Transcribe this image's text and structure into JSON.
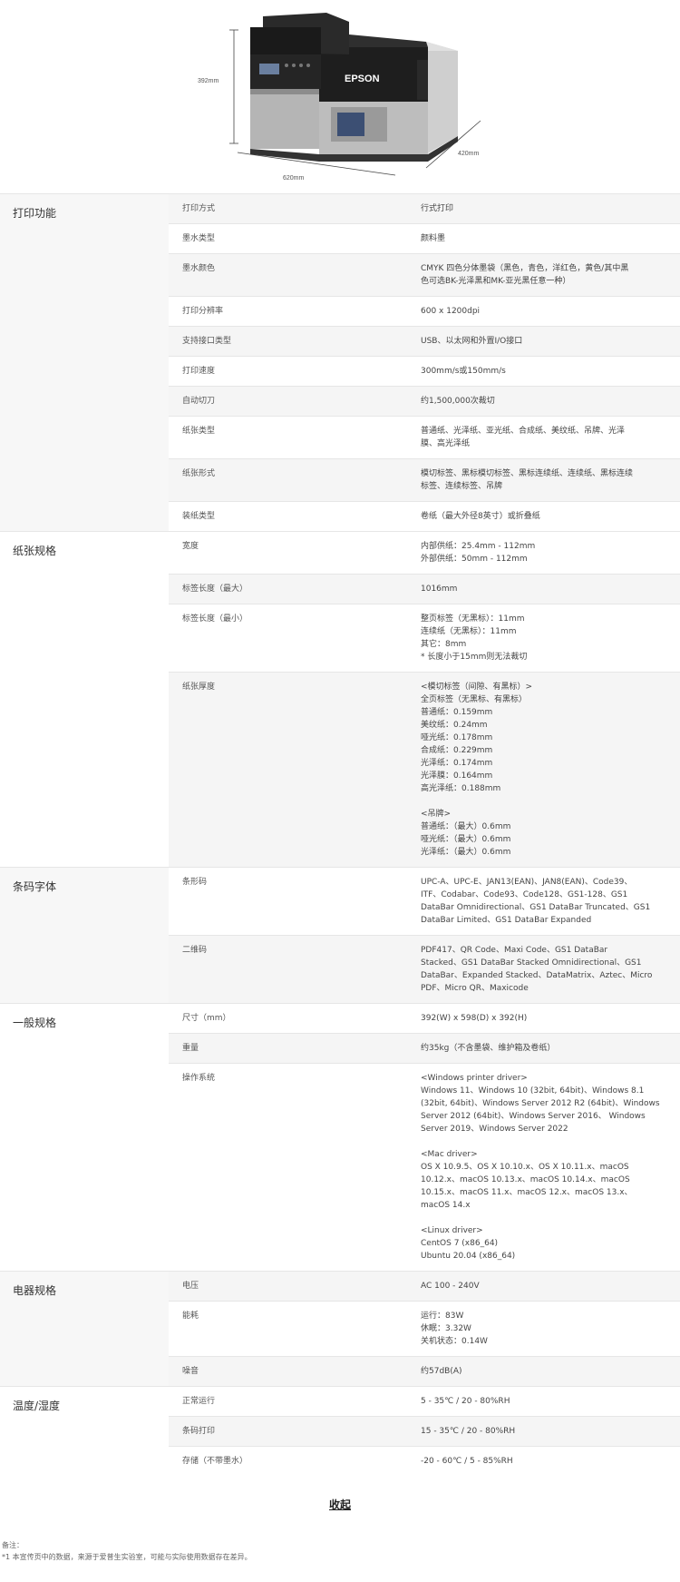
{
  "figure": {
    "height_label": "392mm",
    "width_label": "620mm",
    "depth_label": "420mm",
    "brand": "EPSON"
  },
  "sections": [
    {
      "title": "打印功能",
      "rows": [
        {
          "k": "打印方式",
          "v": "行式打印"
        },
        {
          "k": "墨水类型",
          "v": "颜料墨"
        },
        {
          "k": "墨水颜色",
          "v": "CMYK 四色分体墨袋（黑色，青色，洋红色，黄色/其中黑\n色可选BK-光泽黑和MK-亚光黑任意一种）"
        },
        {
          "k": "打印分辨率",
          "v": "600 x 1200dpi"
        },
        {
          "k": "支持接口类型",
          "v": "USB、以太网和外置I/O接口"
        },
        {
          "k": "打印速度",
          "v": "300mm/s或150mm/s"
        },
        {
          "k": "自动切刀",
          "v": "约1,500,000次裁切"
        },
        {
          "k": "纸张类型",
          "v": "普通纸、光泽纸、亚光纸、合成纸、美纹纸、吊牌、光泽\n膜、高光泽纸"
        },
        {
          "k": "纸张形式",
          "v": "模切标签、黑标模切标签、黑标连续纸、连续纸、黑标连续\n标签、连续标签、吊牌"
        },
        {
          "k": "装纸类型",
          "v": "卷纸（最大外径8英寸）或折叠纸"
        }
      ]
    },
    {
      "title": "纸张规格",
      "rows": [
        {
          "k": "宽度",
          "v": "内部供纸：25.4mm - 112mm\n外部供纸：50mm - 112mm"
        },
        {
          "k": "标签长度（最大）",
          "v": "1016mm"
        },
        {
          "k": "标签长度（最小）",
          "v": "整页标签（无黑标）：11mm\n连续纸（无黑标）：11mm\n其它：8mm\n* 长度小于15mm则无法裁切"
        },
        {
          "k": "纸张厚度",
          "v": "<模切标签（间隙、有黑标）>\n全页标签（无黑标、有黑标）\n普通纸：0.159mm\n美纹纸：0.24mm\n哑光纸：0.178mm\n合成纸：0.229mm\n光泽纸：0.174mm\n光泽膜：0.164mm\n高光泽纸：0.188mm\n\n<吊牌>\n普通纸：（最大）0.6mm\n哑光纸：（最大）0.6mm\n光泽纸：（最大）0.6mm"
        }
      ]
    },
    {
      "title": "条码字体",
      "rows": [
        {
          "k": "条形码",
          "v": "UPC-A、UPC-E、JAN13(EAN)、JAN8(EAN)、Code39、\nITF、Codabar、Code93、Code128、GS1-128、GS1\nDataBar Omnidirectional、GS1 DataBar Truncated、GS1\nDataBar Limited、GS1 DataBar Expanded"
        },
        {
          "k": "二维码",
          "v": "PDF417、QR Code、Maxi Code、GS1 DataBar\nStacked、GS1 DataBar Stacked Omnidirectional、GS1\nDataBar、Expanded Stacked、DataMatrix、Aztec、Micro\nPDF、Micro QR、Maxicode"
        }
      ]
    },
    {
      "title": "一般规格",
      "rows": [
        {
          "k": "尺寸（mm）",
          "v": "392(W) x 598(D) x 392(H)"
        },
        {
          "k": "重量",
          "v": "约35kg（不含墨袋、维护箱及卷纸）"
        },
        {
          "k": "操作系统",
          "v": "<Windows printer driver>\nWindows 11、Windows 10 (32bit, 64bit)、Windows 8.1\n(32bit, 64bit)、Windows Server 2012 R2 (64bit)、Windows\nServer 2012 (64bit)、Windows Server 2016、 Windows\nServer 2019、Windows Server 2022\n\n<Mac driver>\nOS X 10.9.5、OS X 10.10.x、OS X 10.11.x、macOS\n10.12.x、macOS 10.13.x、macOS 10.14.x、macOS\n10.15.x、macOS 11.x、macOS 12.x、macOS 13.x、\nmacOS 14.x\n\n<Linux driver>\nCentOS 7 (x86_64)\nUbuntu 20.04 (x86_64)"
        }
      ]
    },
    {
      "title": "电器规格",
      "rows": [
        {
          "k": "电压",
          "v": "AC 100 - 240V"
        },
        {
          "k": "能耗",
          "v": "运行：83W\n休眠：3.32W\n关机状态：0.14W"
        },
        {
          "k": "噪音",
          "v": "约57dB(A)"
        }
      ]
    },
    {
      "title": "温度/湿度",
      "rows": [
        {
          "k": "正常运行",
          "v": "5 - 35℃ / 20 - 80%RH"
        },
        {
          "k": "条码打印",
          "v": "15 - 35℃ / 20 - 80%RH"
        },
        {
          "k": "存储（不带墨水）",
          "v": "-20 - 60℃ / 5 - 85%RH"
        }
      ]
    }
  ],
  "collapse_label": "收起",
  "notes": {
    "title": "备注：",
    "line1": "*1 本宣传页中的数据，来源于爱普生实验室，可能与实际使用数据存在差异。"
  }
}
